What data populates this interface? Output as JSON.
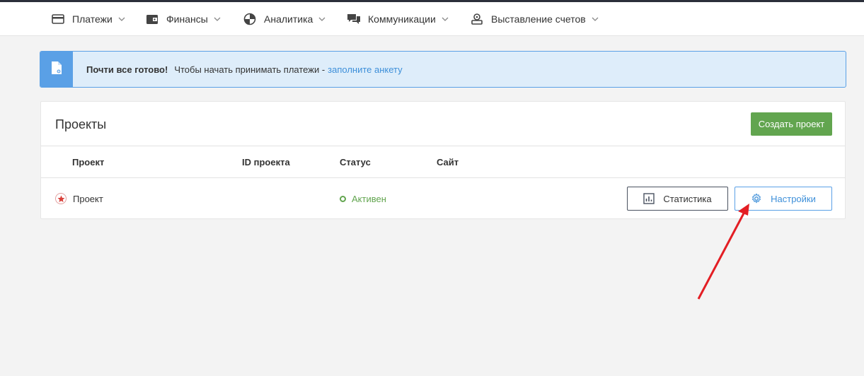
{
  "nav": {
    "items": [
      {
        "label": "Платежи",
        "icon": "card-icon"
      },
      {
        "label": "Финансы",
        "icon": "wallet-icon"
      },
      {
        "label": "Аналитика",
        "icon": "pie-chart-icon"
      },
      {
        "label": "Коммуникации",
        "icon": "chat-icon"
      },
      {
        "label": "Выставление счетов",
        "icon": "invoice-icon"
      }
    ]
  },
  "alert": {
    "icon": "document-icon",
    "title": "Почти все готово!",
    "text": "Чтобы начать принимать платежи -",
    "link": "заполните анкету"
  },
  "projects": {
    "title": "Проекты",
    "create_button": "Создать проект",
    "columns": [
      "Проект",
      "ID проекта",
      "Статус",
      "Сайт"
    ],
    "rows": [
      {
        "name": "Проект",
        "status": "Активен"
      }
    ],
    "stats_button": "Статистика",
    "settings_button": "Настройки"
  },
  "colors": {
    "accent_blue": "#5aa0e6",
    "link_blue": "#3d8fd9",
    "green": "#62a54f",
    "annotation_red": "#e31e24"
  }
}
